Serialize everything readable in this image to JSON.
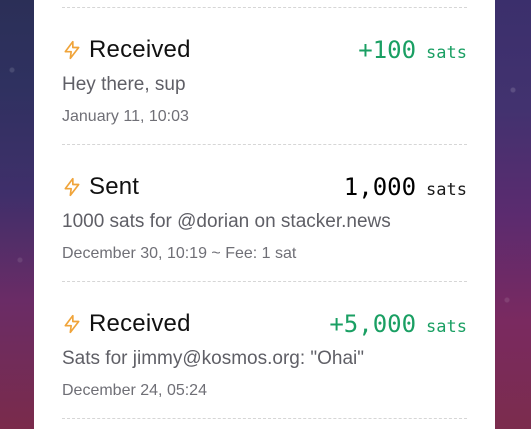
{
  "transactions": [
    {
      "type": "Received",
      "amount": "+100",
      "unit": "sats",
      "description": "Hey there, sup",
      "meta": "January 11, 10:03"
    },
    {
      "type": "Sent",
      "amount": "1,000",
      "unit": "sats",
      "description": "1000 sats for @dorian on stacker.news",
      "meta": "December 30, 10:19 ~ Fee: 1 sat"
    },
    {
      "type": "Received",
      "amount": "+5,000",
      "unit": "sats",
      "description": "Sats for jimmy@kosmos.org: \"Ohai\"",
      "meta": "December 24, 05:24"
    }
  ],
  "icons": {
    "transaction_icon": "lightning-bolt-icon"
  },
  "colors": {
    "positive_amount": "#1a9f63",
    "icon_accent": "#f0a43a"
  }
}
